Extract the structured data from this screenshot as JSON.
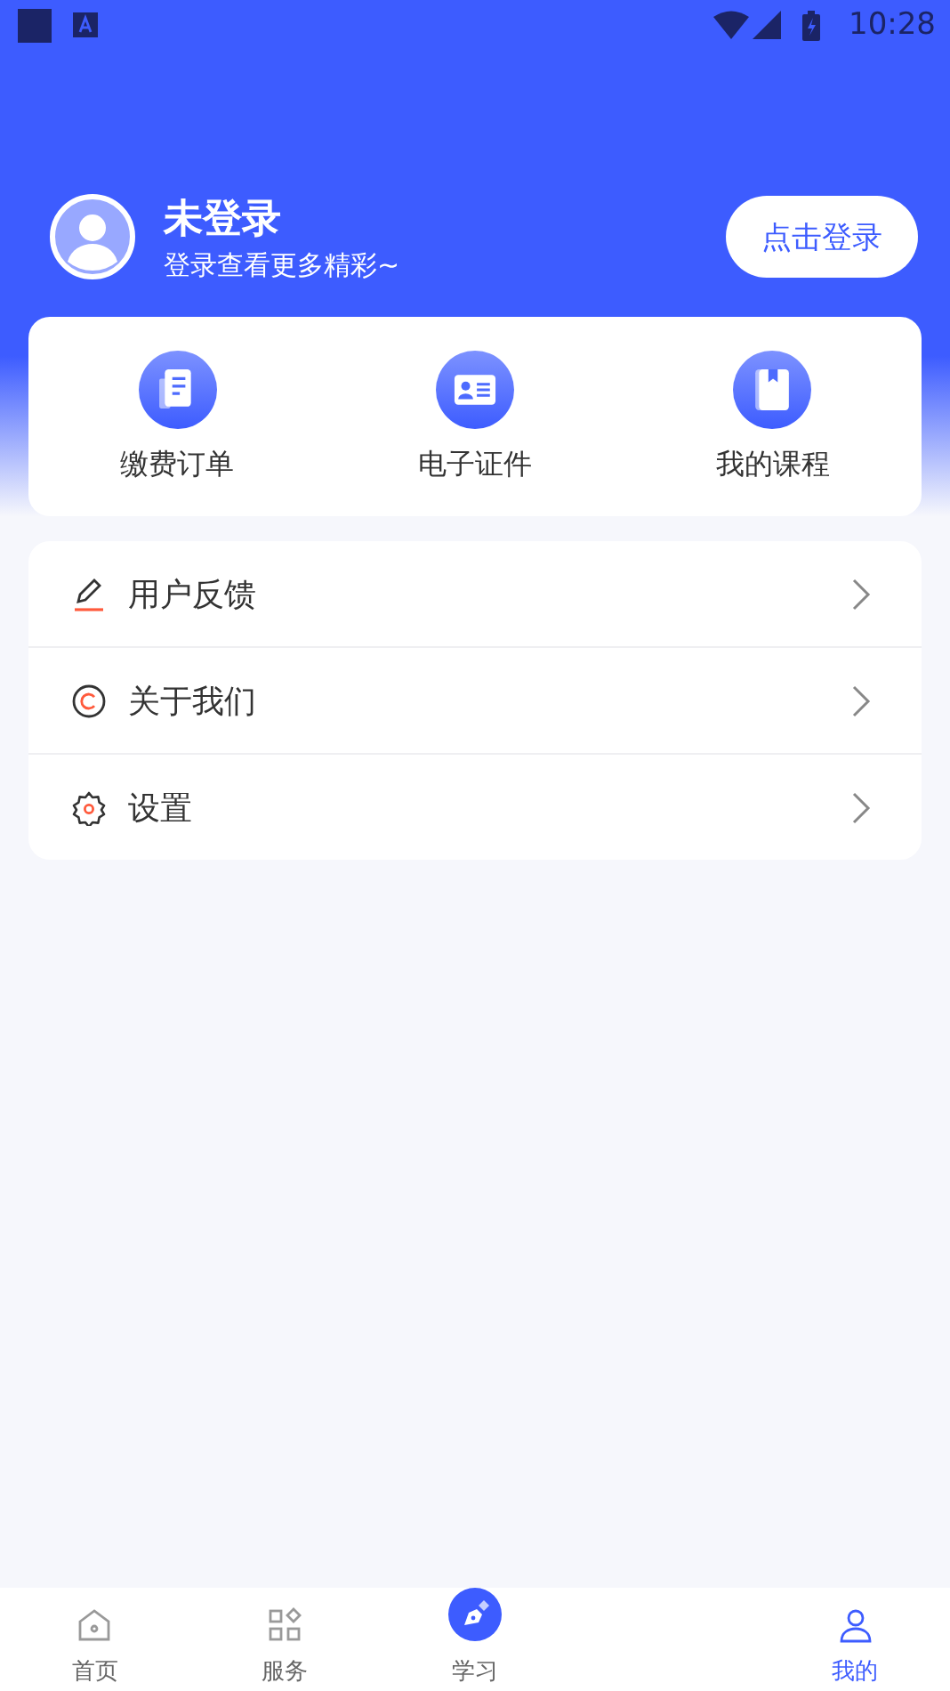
{
  "status_bar": {
    "time": "10:28"
  },
  "profile": {
    "name": "未登录",
    "subtitle": "登录查看更多精彩~",
    "login_button": "点击登录"
  },
  "shortcuts": [
    {
      "label": "缴费订单",
      "kind": "orders"
    },
    {
      "label": "电子证件",
      "kind": "card"
    },
    {
      "label": "我的课程",
      "kind": "course"
    }
  ],
  "menu": [
    {
      "label": "用户反馈",
      "kind": "feedback"
    },
    {
      "label": "关于我们",
      "kind": "about"
    },
    {
      "label": "设置",
      "kind": "settings"
    }
  ],
  "tab_bar": [
    {
      "label": "首页",
      "kind": "home",
      "selected": false
    },
    {
      "label": "服务",
      "kind": "service",
      "selected": false
    },
    {
      "label": "学习",
      "kind": "study",
      "selected": false
    },
    {
      "label": "我的",
      "kind": "mine",
      "selected": true
    }
  ]
}
